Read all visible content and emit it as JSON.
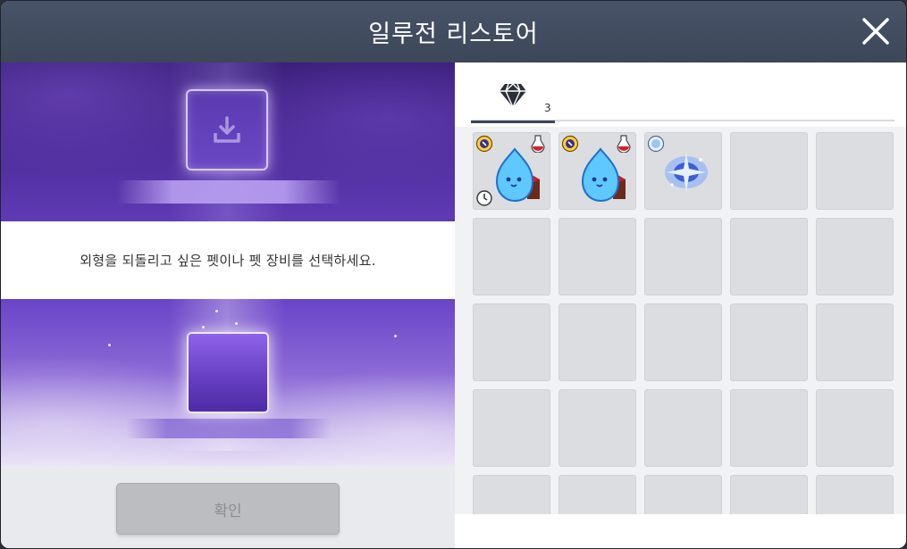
{
  "window": {
    "title": "일루전 리스토어"
  },
  "left_panel": {
    "message": "외형을 되돌리고 싶은 펫이나 펫 장비를 선택하세요.",
    "confirm_label": "확인"
  },
  "right_panel": {
    "tab": {
      "icon": "diamond-icon",
      "count": "3"
    },
    "inventory": {
      "rows": 5,
      "columns": 5,
      "items": [
        {
          "slot": 0,
          "icon": "blue-spirit-pet-icon",
          "badges": [
            "magnifier-icon",
            "potion-icon",
            "clock-icon"
          ]
        },
        {
          "slot": 1,
          "icon": "blue-spirit-pet-icon",
          "badges": [
            "magnifier-icon",
            "potion-icon"
          ]
        },
        {
          "slot": 2,
          "icon": "blue-sparkle-orb-icon",
          "badges": [
            "magnifier-icon"
          ]
        }
      ]
    }
  },
  "colors": {
    "header": "#485368",
    "accent_purple": "#5b3ab0",
    "cell": "#dcdde0"
  }
}
